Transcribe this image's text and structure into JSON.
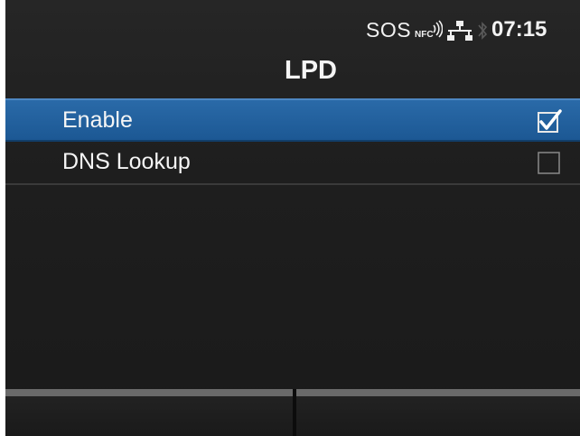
{
  "status_bar": {
    "sos_label": "SOS",
    "nfc_icon": "nfc-icon",
    "network_icon": "network-icon",
    "bluetooth_icon": "bluetooth-icon",
    "time": "07:15"
  },
  "header": {
    "title": "LPD"
  },
  "menu": {
    "items": [
      {
        "label": "Enable",
        "checked": true,
        "selected": true
      },
      {
        "label": "DNS Lookup",
        "checked": false,
        "selected": false
      }
    ]
  },
  "softkeys": {
    "left_label": "",
    "right_label": ""
  },
  "colors": {
    "selection": "#1f5e9c",
    "background": "#1f1f1f",
    "softkey_bar": "#6a6a6a"
  }
}
